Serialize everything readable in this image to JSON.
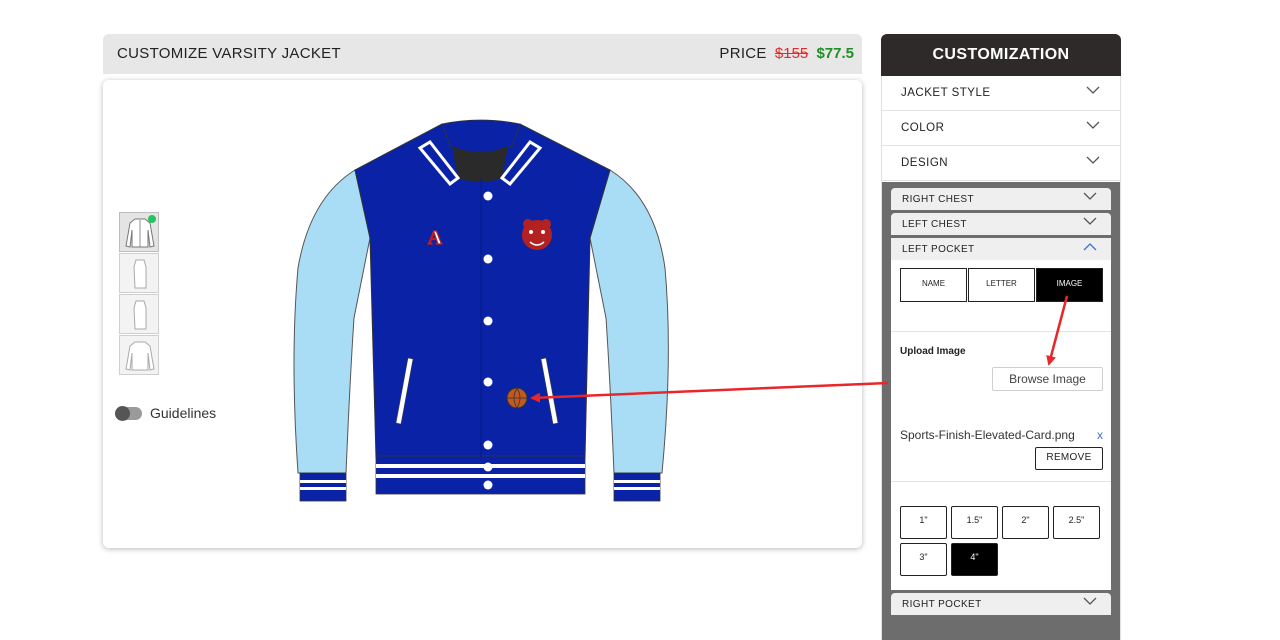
{
  "editor": {
    "title": "CUSTOMIZE VARSITY JACKET",
    "price_label": "PRICE",
    "price_old": "$155",
    "price_new": "$77.5",
    "guidelines_label": "Guidelines",
    "jacket": {
      "letter_patch": "A",
      "body_color": "#0a23a6",
      "sleeve_color": "#a9ddf6",
      "stripe_color": "#ffffff"
    }
  },
  "panel": {
    "title": "CUSTOMIZATION",
    "sections": [
      {
        "label": "JACKET STYLE"
      },
      {
        "label": "COLOR"
      },
      {
        "label": "DESIGN"
      }
    ],
    "design": {
      "subsections": [
        {
          "label": "RIGHT CHEST"
        },
        {
          "label": "LEFT CHEST"
        }
      ],
      "open_section": {
        "label": "LEFT POCKET",
        "type_tabs": [
          "NAME",
          "LETTER",
          "IMAGE"
        ],
        "selected_tab": "IMAGE",
        "upload_label": "Upload Image",
        "browse_label": "Browse Image",
        "file_name": "Sports-Finish-Elevated-Card.png",
        "file_remove_x": "x",
        "remove_label": "REMOVE",
        "sizes": [
          "1\"",
          "1.5\"",
          "2\"",
          "2.5\"",
          "3\"",
          "4\""
        ],
        "selected_size": "4\""
      },
      "after_subsections": [
        {
          "label": "RIGHT POCKET"
        }
      ]
    }
  },
  "colors": {
    "panel_header": "#2f2a2a",
    "price_old": "#e32b2b",
    "price_new": "#1e8e25",
    "annotation_arrow": "#e8272b"
  }
}
